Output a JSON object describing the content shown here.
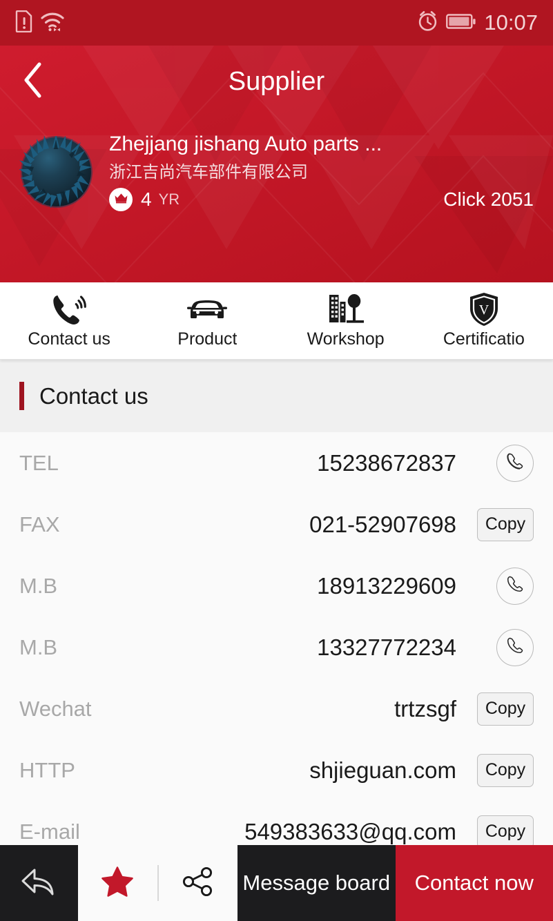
{
  "status_bar": {
    "time": "10:07",
    "icons_left": [
      "sim-card-alert-icon",
      "wifi-icon"
    ],
    "icons_right": [
      "alarm-clock-icon",
      "battery-icon"
    ]
  },
  "header": {
    "title": "Supplier",
    "back_icon": "chevron-left-icon",
    "background_color": "#c2182a"
  },
  "company": {
    "logo_alt": "company-logo",
    "name_en": "Zhejjang jishang Auto parts ...",
    "name_cn": "浙江吉尚汽车部件有限公司",
    "badge_icon": "crown-icon",
    "years": "4",
    "years_unit": "YR",
    "click_label": "Click 2051"
  },
  "tabs": [
    {
      "label": "Contact us",
      "icon": "phone-ringing-icon",
      "active": true
    },
    {
      "label": "Product",
      "icon": "car-icon",
      "active": false
    },
    {
      "label": "Workshop",
      "icon": "factory-tree-icon",
      "active": false
    },
    {
      "label": "Certificatio",
      "icon": "shield-verified-icon",
      "active": false
    }
  ],
  "section": {
    "title": "Contact us",
    "accent_color": "#9e1420"
  },
  "contacts": [
    {
      "label": "TEL",
      "value": "15238672837",
      "action": "call",
      "action_label": ""
    },
    {
      "label": "FAX",
      "value": "021-52907698",
      "action": "copy",
      "action_label": "Copy"
    },
    {
      "label": "M.B",
      "value": "18913229609",
      "action": "call",
      "action_label": ""
    },
    {
      "label": "M.B",
      "value": "13327772234",
      "action": "call",
      "action_label": ""
    },
    {
      "label": "Wechat",
      "value": "trtzsgf",
      "action": "copy",
      "action_label": "Copy"
    },
    {
      "label": "HTTP",
      "value": "shjieguan.com",
      "action": "copy",
      "action_label": "Copy"
    },
    {
      "label": "E-mail",
      "value": "549383633@qq.com",
      "action": "copy",
      "action_label": "Copy"
    }
  ],
  "bottom_bar": {
    "back_icon": "reply-arrow-icon",
    "favorite_icon": "star-filled-icon",
    "favorite_color": "#c2182a",
    "share_icon": "share-nodes-icon",
    "message_label": "Message board",
    "contact_label": "Contact now",
    "message_bg": "#1c1c1e",
    "contact_bg": "#c2182a"
  }
}
